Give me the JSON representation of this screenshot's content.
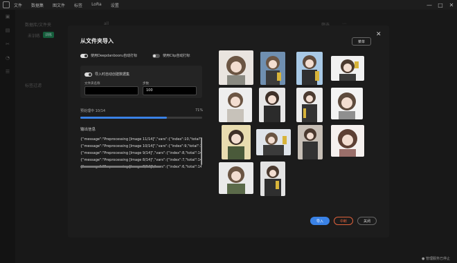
{
  "menu": [
    "文件",
    "数据集",
    "图文件",
    "标签",
    "LoRa",
    "设置"
  ],
  "window_controls": [
    "—",
    "□",
    "✕"
  ],
  "background": {
    "tab_a": "数据库/文件夹",
    "tab_b": "all",
    "item_label": "未训练",
    "item_badge": "训练",
    "side_label": "标签过滤",
    "filter_label": "筛选",
    "filter_extra": "⋯"
  },
  "modal": {
    "title": "从文件夹导入",
    "lock_button": "菜单",
    "toggle1_label": "使用Deepdanbooru自动打标",
    "toggle2_label": "使用Clip自动打标",
    "toggle3_label": "导入时自动创建数据集",
    "field_name_label": "文件夹名称",
    "field_name_value": "",
    "field_steps_label": "步数",
    "field_steps_value": "100",
    "progress_label": "预处理中 10/14",
    "progress_percent": "71%",
    "progress_fraction": 0.71,
    "log_title": "输出信息",
    "log_lines": [
      "{\"message\":\"Preprocessing [Image 11/14]\",\"vars\":{\"index\":10,\"total\":14",
      "{\"message\":\"Preprocessing [Image 10/14]\",\"vars\":{\"index\":9,\"total\":14",
      "{\"message\":\"Preprocessing [Image 9/14]\",\"vars\":{\"index\":8,\"total\":14",
      "{\"message\":\"Preprocessing [Image 8/14]\",\"vars\":{\"index\":7,\"total\":14",
      "{\"message\":\"Preprocessing [Image 7/14]\",\"vars\":{\"index\":6,\"total\":14"
    ],
    "buttons": {
      "import": "导入",
      "interrupt": "中断",
      "close": "关闭"
    }
  },
  "footer_status": "● 管理服务已停止",
  "colors": {
    "accent": "#3a82e6",
    "interrupt_border": "#e0623c",
    "badge": "#1f8f5a"
  }
}
